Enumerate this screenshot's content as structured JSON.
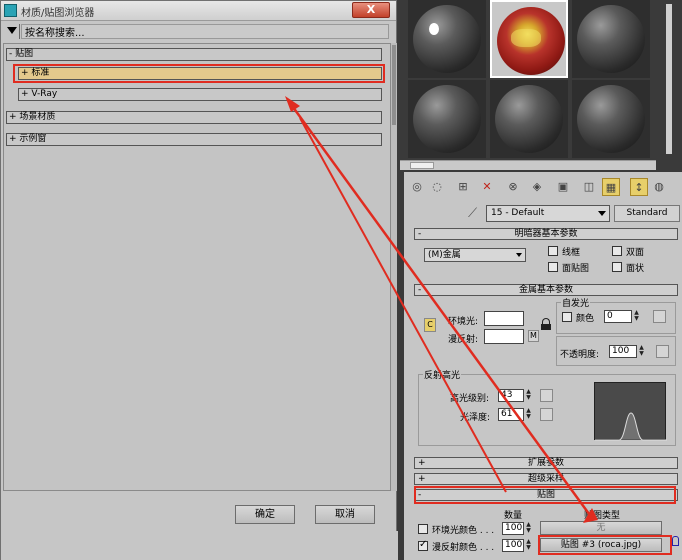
{
  "browser": {
    "title": "材质/贴图浏览器",
    "close_label": "X",
    "search_value": "按名称搜索...",
    "groups": [
      {
        "label": "- 贴图",
        "children": [
          {
            "label": "+ 标准",
            "selected": true
          },
          {
            "label": "+ V-Ray",
            "selected": false
          }
        ]
      },
      {
        "label": "+ 场景材质"
      },
      {
        "label": "+ 示例窗"
      }
    ],
    "ok_label": "确定",
    "cancel_label": "取消"
  },
  "editor": {
    "material_name": "15 - Default",
    "material_type": "Standard",
    "shader_rollout": "明暗器基本参数",
    "shader_value": "(M)金属",
    "shader_options": {
      "wire": "线框",
      "two_sided": "双面",
      "face_map": "面贴图",
      "faceted": "面状"
    },
    "metal_rollout": "金属基本参数",
    "self_illum": {
      "title": "自发光",
      "color_label": "颜色",
      "value": "0"
    },
    "ambient_label": "环境光:",
    "diffuse_label": "漫反射:",
    "lock_label": "C",
    "map_btn": "M",
    "opacity": {
      "label": "不透明度:",
      "value": "100"
    },
    "specular": {
      "title": "反射高光",
      "level_label": "高光级别:",
      "level_value": "43",
      "gloss_label": "光泽度:",
      "gloss_value": "61"
    },
    "rollouts": {
      "extended": "扩展参数",
      "supersampling": "超级采样",
      "maps": "贴图"
    },
    "maps_table": {
      "col_amount": "数量",
      "col_type": "贴图类型",
      "rows": [
        {
          "label": "环境光颜色 . . .",
          "checked": false,
          "amount": "100",
          "map": "无"
        },
        {
          "label": "漫反射颜色 . . .",
          "checked": true,
          "amount": "100",
          "map": "贴图 #3 (roca.jpg)"
        }
      ]
    }
  },
  "colors": {
    "highlight_red": "#e02c20",
    "selected_row": "#e4c98c",
    "panel_bg": "#c6c6c6"
  }
}
